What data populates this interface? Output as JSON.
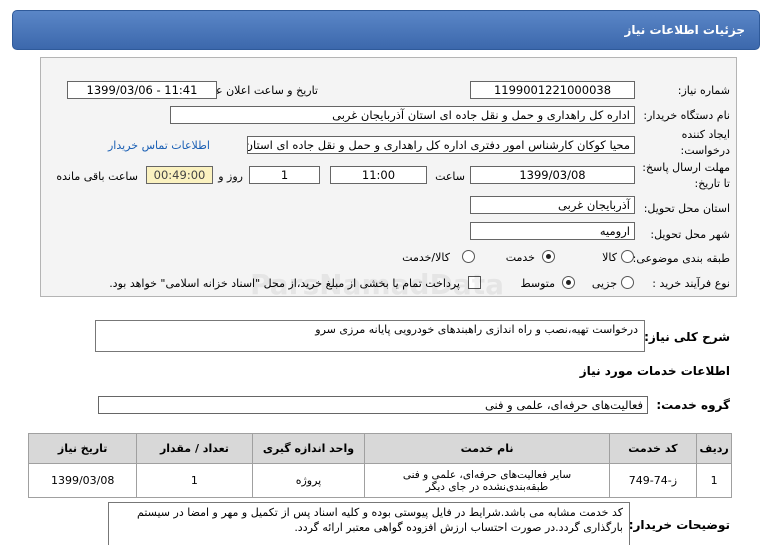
{
  "header": {
    "title": "جزئیات اطلاعات نیاز"
  },
  "need_number": {
    "label": "شماره نیاز:",
    "value": "1199001221000038"
  },
  "announce": {
    "label": "تاریخ و ساعت اعلان عمومی:",
    "value": "1399/03/06 - 11:41"
  },
  "buyer": {
    "label": "نام دستگاه خریدار:",
    "value": "اداره کل راهداری و حمل و نقل جاده ای استان آذربایجان غربی"
  },
  "creator": {
    "label1": "ایجاد کننده",
    "label2": "درخواست:",
    "value": "محیا کوکان کارشناس امور دفتری اداره کل راهداری و حمل و نقل جاده ای استان",
    "contact_link": "اطلاعات تماس خریدار"
  },
  "deadline": {
    "label1": "مهلت ارسال پاسخ:",
    "label2": "تا تاریخ:",
    "date": "1399/03/08",
    "time_label": "ساعت",
    "time": "11:00",
    "days": "1",
    "days_label": "روز و",
    "remaining": "00:49:00",
    "remaining_label": "ساعت باقی مانده"
  },
  "province": {
    "label": "استان محل تحویل:",
    "value": "آذربایجان غربی"
  },
  "city": {
    "label": "شهر محل تحویل:",
    "value": "ارومیه"
  },
  "category": {
    "label": "طبقه بندی موضوعی:",
    "options": [
      "کالا",
      "خدمت",
      "کالا/خدمت"
    ],
    "selected": "خدمت"
  },
  "purchase": {
    "label": "نوع فرآیند خرید :",
    "options": [
      "جزیی",
      "متوسط"
    ],
    "selected": "متوسط",
    "note": "پرداخت تمام یا بخشی از مبلغ خرید،از محل \"اسناد خزانه اسلامی\" خواهد بود."
  },
  "summary": {
    "label": "شرح کلی نیاز:",
    "value": "درخواست تهیه،نصب و راه اندازی راهبندهای خودرویی پایانه مرزی سرو"
  },
  "services_info": {
    "title": "اطلاعات خدمات مورد نیاز"
  },
  "service_group": {
    "label": "گروه خدمت:",
    "value": "فعالیت‌های حرفه‌ای، علمی و فنی"
  },
  "table": {
    "headers": [
      "ردیف",
      "کد خدمت",
      "نام خدمت",
      "واحد اندازه گیری",
      "تعداد / مقدار",
      "تاریخ نیاز"
    ],
    "rows": [
      [
        "1",
        "ز-74-749",
        "سایر فعالیت‌های حرفه‌ای، علمی و فنی طبقه‌بندی‌نشده در جای دیگر",
        "پروژه",
        "1",
        "1399/03/08"
      ]
    ]
  },
  "buyer_notes": {
    "label": "توضیحات خریدار:",
    "value": "کد خدمت مشابه می باشد.شرایط در فایل پیوستی بوده و کلیه اسناد پس از تکمیل و مهر و امضا در سیستم بارگذاری گردد.در صورت احتساب ارزش افزوده گواهی معتبر ارائه گردد."
  },
  "watermark": {
    "text": "ParsNamadData"
  }
}
